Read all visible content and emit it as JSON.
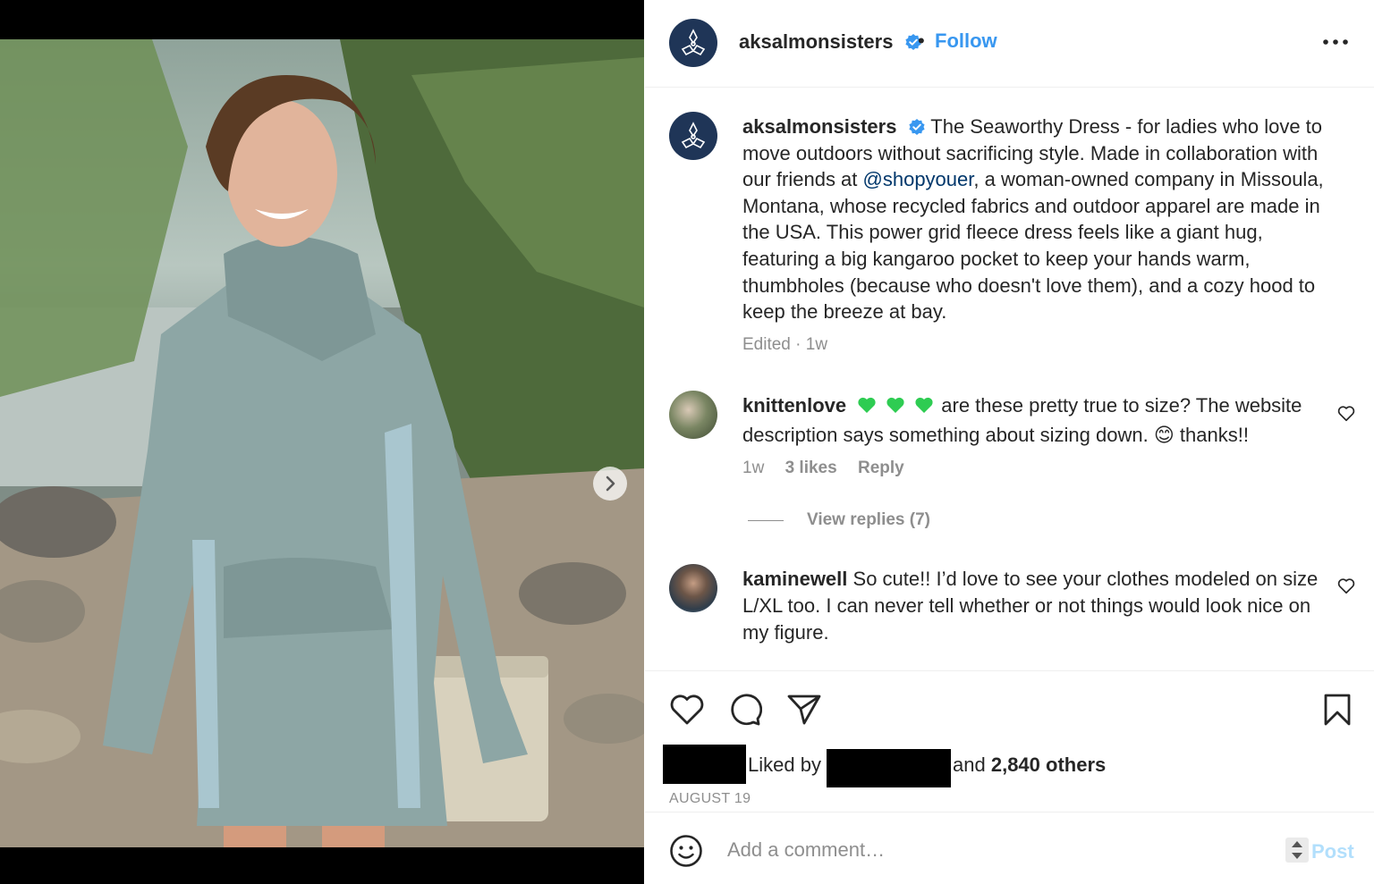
{
  "post": {
    "username": "aksalmonsisters",
    "follow_label": "Follow",
    "separator": "•"
  },
  "caption": {
    "username": "aksalmonsisters",
    "text_before_mention": "The Seaworthy Dress - for ladies who love to move outdoors without sacrificing style. Made in collaboration with our friends at ",
    "mention": "@shopyouer",
    "text_after_mention": ", a woman-owned company in Missoula, Montana, whose recycled fabrics and outdoor apparel are made in the USA. This power grid fleece dress feels like a giant hug, featuring a big kangaroo pocket to keep your hands warm, thumbholes (because who doesn't love them), and a cozy hood to keep the breeze at bay.",
    "meta": "Edited · 1w"
  },
  "comments": [
    {
      "username": "knittenlove",
      "text_before_emoji": "are these pretty true to size? The website description says something about sizing down.",
      "emoji": "😊",
      "text_after_emoji": "thanks!!",
      "time": "1w",
      "likes": "3 likes",
      "reply_label": "Reply",
      "view_replies": "View replies (7)"
    },
    {
      "username": "kaminewell",
      "text": "So cute!! I’d love to see your clothes modeled on size L/XL too. I can never tell whether or not things would look nice on my figure."
    }
  ],
  "likes": {
    "prefix": "Liked by",
    "middle": "and",
    "count": "2,840 others"
  },
  "date": "AUGUST 19",
  "add_comment": {
    "placeholder": "Add a comment…",
    "post_label": "Post"
  },
  "carousel": {
    "total_slides": 5,
    "active_slide": 1
  },
  "colors": {
    "accent": "#3897f0",
    "mention": "#00376b",
    "muted": "#8e8e8e",
    "brand_avatar": "#1f3557",
    "hearts": "#2ecc52",
    "post_disabled": "#b2dffc"
  }
}
